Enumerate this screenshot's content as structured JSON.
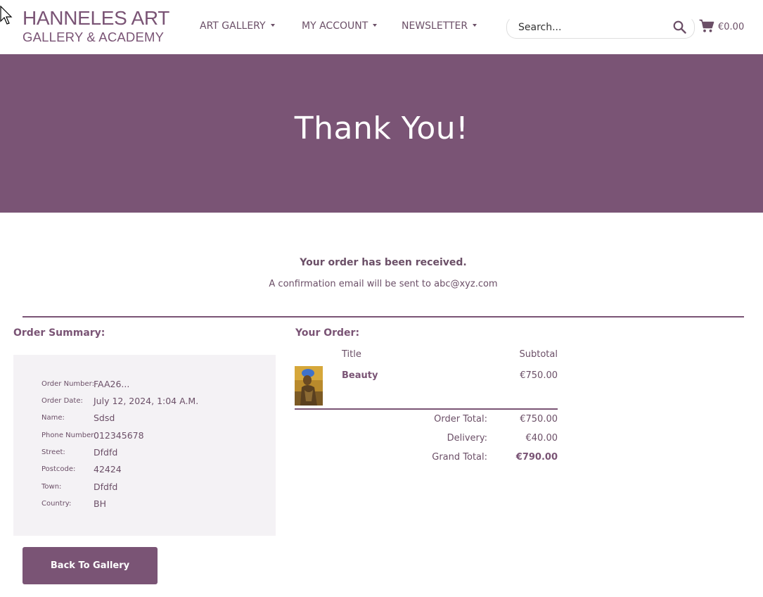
{
  "header": {
    "brand_line1": "HANNELES ART",
    "brand_line2": "GALLERY & ACADEMY",
    "nav": [
      {
        "label": "ART GALLERY"
      },
      {
        "label": "MY ACCOUNT"
      },
      {
        "label": "NEWSLETTER"
      }
    ],
    "search_placeholder": "Search...",
    "cart_total": "€0.00"
  },
  "hero": {
    "title": "Thank You!"
  },
  "confirmation": {
    "received": "Your order has been received.",
    "email_notice": "A confirmation email will be sent to abc@xyz.com"
  },
  "summary": {
    "heading": "Order Summary:",
    "rows": [
      {
        "key": "Order Number:",
        "value": "FAA26..."
      },
      {
        "key": "Order Date:",
        "value": "July 12, 2024, 1:04 A.M."
      },
      {
        "key": "Name:",
        "value": "Sdsd"
      },
      {
        "key": "Phone Number:",
        "value": "012345678"
      },
      {
        "key": "Street:",
        "value": "Dfdfd"
      },
      {
        "key": "Postcode:",
        "value": "42424"
      },
      {
        "key": "Town:",
        "value": "Dfdfd"
      },
      {
        "key": "Country:",
        "value": "BH"
      }
    ],
    "back_button": "Back To Gallery"
  },
  "order": {
    "heading": "Your Order:",
    "col_title": "Title",
    "col_subtotal": "Subtotal",
    "items": [
      {
        "title": "Beauty",
        "subtotal": "€750.00"
      }
    ],
    "totals": [
      {
        "key": "Order Total:",
        "value": "€750.00"
      },
      {
        "key": "Delivery:",
        "value": "€40.00"
      },
      {
        "key": "Grand Total:",
        "value": "€790.00"
      }
    ]
  },
  "colors": {
    "brand": "#7a5475",
    "panel": "#f4f2f5"
  }
}
